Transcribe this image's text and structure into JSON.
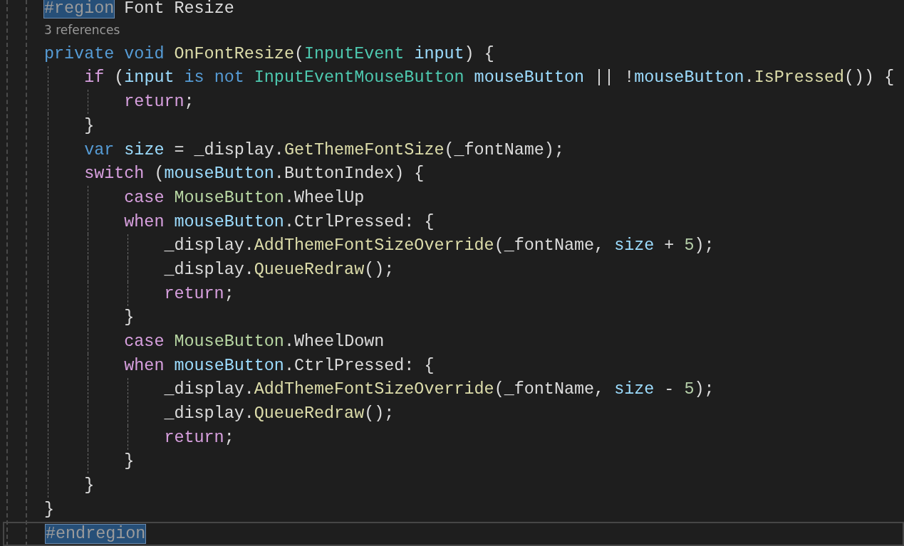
{
  "region": {
    "directive": "#region",
    "directive_highlighted": true,
    "name": "Font Resize"
  },
  "codelens": "3 references",
  "lines": [
    [
      {
        "kind": "keyword",
        "text": "private void "
      },
      {
        "kind": "method",
        "text": "OnFontResize"
      },
      {
        "kind": "plain",
        "text": "("
      },
      {
        "kind": "type",
        "text": "InputEvent "
      },
      {
        "kind": "variable",
        "text": "input"
      },
      {
        "kind": "plain",
        "text": ") {"
      }
    ],
    [
      {
        "kind": "control",
        "text": "    if"
      },
      {
        "kind": "plain",
        "text": " ("
      },
      {
        "kind": "variable",
        "text": "input"
      },
      {
        "kind": "keyword",
        "text": " is not "
      },
      {
        "kind": "type",
        "text": "InputEventMouseButton"
      },
      {
        "kind": "variable",
        "text": " mouseButton"
      },
      {
        "kind": "plain",
        "text": " || !"
      },
      {
        "kind": "variable",
        "text": "mouseButton"
      },
      {
        "kind": "plain",
        "text": "."
      },
      {
        "kind": "method",
        "text": "IsPressed"
      },
      {
        "kind": "plain",
        "text": "()) {"
      }
    ],
    [
      {
        "kind": "control",
        "text": "        return"
      },
      {
        "kind": "plain",
        "text": ";"
      }
    ],
    [
      {
        "kind": "plain",
        "text": "    }"
      }
    ],
    [
      {
        "kind": "keyword",
        "text": "    var"
      },
      {
        "kind": "variable",
        "text": " size"
      },
      {
        "kind": "plain",
        "text": " = _display."
      },
      {
        "kind": "method",
        "text": "GetThemeFontSize"
      },
      {
        "kind": "plain",
        "text": "(_fontName);"
      }
    ],
    [
      {
        "kind": "control",
        "text": "    switch"
      },
      {
        "kind": "plain",
        "text": " ("
      },
      {
        "kind": "variable",
        "text": "mouseButton"
      },
      {
        "kind": "plain",
        "text": ".ButtonIndex) {"
      }
    ],
    [
      {
        "kind": "control",
        "text": "        case"
      },
      {
        "kind": "enum",
        "text": " MouseButton"
      },
      {
        "kind": "plain",
        "text": ".WheelUp"
      }
    ],
    [
      {
        "kind": "control",
        "text": "        when"
      },
      {
        "kind": "variable",
        "text": " mouseButton"
      },
      {
        "kind": "plain",
        "text": ".CtrlPressed: {"
      }
    ],
    [
      {
        "kind": "plain",
        "text": "            _display."
      },
      {
        "kind": "method",
        "text": "AddThemeFontSizeOverride"
      },
      {
        "kind": "plain",
        "text": "(_fontName, "
      },
      {
        "kind": "variable",
        "text": "size"
      },
      {
        "kind": "plain",
        "text": " + "
      },
      {
        "kind": "number",
        "text": "5"
      },
      {
        "kind": "plain",
        "text": ");"
      }
    ],
    [
      {
        "kind": "plain",
        "text": "            _display."
      },
      {
        "kind": "method",
        "text": "QueueRedraw"
      },
      {
        "kind": "plain",
        "text": "();"
      }
    ],
    [
      {
        "kind": "control",
        "text": "            return"
      },
      {
        "kind": "plain",
        "text": ";"
      }
    ],
    [
      {
        "kind": "plain",
        "text": "        }"
      }
    ],
    [
      {
        "kind": "control",
        "text": "        case"
      },
      {
        "kind": "enum",
        "text": " MouseButton"
      },
      {
        "kind": "plain",
        "text": ".WheelDown"
      }
    ],
    [
      {
        "kind": "control",
        "text": "        when"
      },
      {
        "kind": "variable",
        "text": " mouseButton"
      },
      {
        "kind": "plain",
        "text": ".CtrlPressed: {"
      }
    ],
    [
      {
        "kind": "plain",
        "text": "            _display."
      },
      {
        "kind": "method",
        "text": "AddThemeFontSizeOverride"
      },
      {
        "kind": "plain",
        "text": "(_fontName, "
      },
      {
        "kind": "variable",
        "text": "size"
      },
      {
        "kind": "plain",
        "text": " - "
      },
      {
        "kind": "number",
        "text": "5"
      },
      {
        "kind": "plain",
        "text": ");"
      }
    ],
    [
      {
        "kind": "plain",
        "text": "            _display."
      },
      {
        "kind": "method",
        "text": "QueueRedraw"
      },
      {
        "kind": "plain",
        "text": "();"
      }
    ],
    [
      {
        "kind": "control",
        "text": "            return"
      },
      {
        "kind": "plain",
        "text": ";"
      }
    ],
    [
      {
        "kind": "plain",
        "text": "        }"
      }
    ],
    [
      {
        "kind": "plain",
        "text": "    }"
      }
    ],
    [
      {
        "kind": "plain",
        "text": "}"
      }
    ]
  ],
  "endregion": {
    "directive": "#endregion",
    "highlighted": true,
    "current_line": true
  }
}
